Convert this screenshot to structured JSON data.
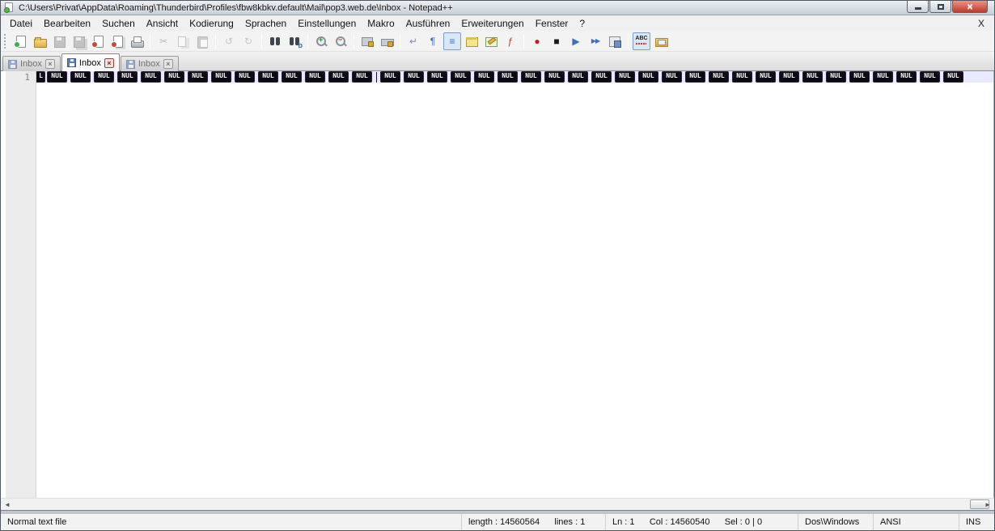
{
  "window": {
    "title": "C:\\Users\\Privat\\AppData\\Roaming\\Thunderbird\\Profiles\\fbw8kbkv.default\\Mail\\pop3.web.de\\Inbox - Notepad++",
    "controls": {
      "close_glyph": "×"
    }
  },
  "menu": {
    "items": [
      "Datei",
      "Bearbeiten",
      "Suchen",
      "Ansicht",
      "Kodierung",
      "Sprachen",
      "Einstellungen",
      "Makro",
      "Ausführen",
      "Erweiterungen",
      "Fenster",
      "?"
    ],
    "close_label": "X"
  },
  "toolbar": {
    "buttons": [
      {
        "name": "new-file-button",
        "icon": "new-file"
      },
      {
        "name": "open-file-button",
        "icon": "open-folder"
      },
      {
        "name": "save-button",
        "icon": "save",
        "disabled": true
      },
      {
        "name": "save-all-button",
        "icon": "save-all",
        "disabled": true
      },
      {
        "name": "close-file-button",
        "icon": "close-file"
      },
      {
        "name": "close-all-button",
        "icon": "close-all"
      },
      {
        "name": "print-button",
        "icon": "print"
      },
      {
        "sep": true
      },
      {
        "name": "cut-button",
        "icon": "cut",
        "glyph": "✂",
        "color": "#6E747C",
        "disabled": true
      },
      {
        "name": "copy-button",
        "icon": "copy",
        "disabled": true
      },
      {
        "name": "paste-button",
        "icon": "paste",
        "disabled": true
      },
      {
        "sep": true
      },
      {
        "name": "undo-button",
        "icon": "undo",
        "glyph": "↺",
        "color": "#8A9099",
        "disabled": true
      },
      {
        "name": "redo-button",
        "icon": "redo",
        "glyph": "↻",
        "color": "#8A9099",
        "disabled": true
      },
      {
        "sep": true
      },
      {
        "name": "find-button",
        "icon": "find"
      },
      {
        "name": "replace-button",
        "icon": "replace"
      },
      {
        "sep": true
      },
      {
        "name": "zoom-in-button",
        "icon": "zoom-in"
      },
      {
        "name": "zoom-out-button",
        "icon": "zoom-out"
      },
      {
        "sep": true
      },
      {
        "name": "sync-vertical-scroll-button",
        "icon": "sync-v"
      },
      {
        "name": "sync-horizontal-scroll-button",
        "icon": "sync-h"
      },
      {
        "sep": true
      },
      {
        "name": "word-wrap-button",
        "icon": "word-wrap",
        "glyph": "↵",
        "color": "#7A8FB9"
      },
      {
        "name": "show-all-characters-button",
        "icon": "pilcrow",
        "glyph": "¶",
        "color": "#3D6FC4"
      },
      {
        "name": "show-indent-guide-button",
        "icon": "indent-guide",
        "glyph": "≡",
        "color": "#3D6FC4",
        "pressed": true
      },
      {
        "name": "user-defined-dialog-button",
        "icon": "window-yellow"
      },
      {
        "name": "document-map-button",
        "icon": "window-pencil"
      },
      {
        "name": "function-list-button",
        "icon": "function-list",
        "glyph": "ƒ",
        "color": "#B53A33"
      },
      {
        "sep": true
      },
      {
        "name": "macro-record-button",
        "icon": "record",
        "glyph": "●",
        "color": "#C41E1E"
      },
      {
        "name": "macro-stop-button",
        "icon": "stop",
        "glyph": "■",
        "color": "#1A1A1A"
      },
      {
        "name": "macro-play-button",
        "icon": "play",
        "glyph": "▶",
        "color": "#3D6FC4"
      },
      {
        "name": "macro-run-multiple-button",
        "icon": "play-multiple",
        "glyph": "▶▶",
        "color": "#3D6FC4",
        "small": true
      },
      {
        "name": "macro-save-button",
        "icon": "macro-save"
      },
      {
        "sep": true
      },
      {
        "name": "spell-check-button",
        "icon": "spell-abc",
        "pressed": true
      },
      {
        "name": "plugin-button",
        "icon": "plugin-folder"
      }
    ]
  },
  "tab_bar": {
    "close_glyph": "×",
    "tabs": [
      {
        "label": "Inbox",
        "active": false
      },
      {
        "label": "Inbox",
        "active": true
      },
      {
        "label": "Inbox",
        "active": false
      }
    ]
  },
  "editor": {
    "line_number": "1",
    "visible_partial_token": "L",
    "control_char_token": "NUL",
    "blocks_before_caret": 14,
    "blocks_after_caret": 25
  },
  "scrollbar": {
    "left_glyph": "◄",
    "right_glyph": "►"
  },
  "status_bar": {
    "sections": [
      {
        "name": "doc-type",
        "text": "Normal text file"
      },
      {
        "name": "length-lines",
        "text": "length : 14560564      lines : 1"
      },
      {
        "name": "cursor-pos",
        "text": "Ln : 1      Col : 14560540      Sel : 0 | 0"
      },
      {
        "name": "eol-format",
        "text": "Dos\\Windows"
      },
      {
        "name": "encoding",
        "text": "ANSI"
      },
      {
        "name": "insert-mode",
        "text": "INS"
      }
    ]
  },
  "colors": {
    "caret_line_bg": "#E8E8FF",
    "control_char_bg": "#0E0A14",
    "control_char_fg": "#FFFFFF",
    "close_button_red": "#C03A28",
    "pressed_button_bg": "#D9E7F7"
  }
}
